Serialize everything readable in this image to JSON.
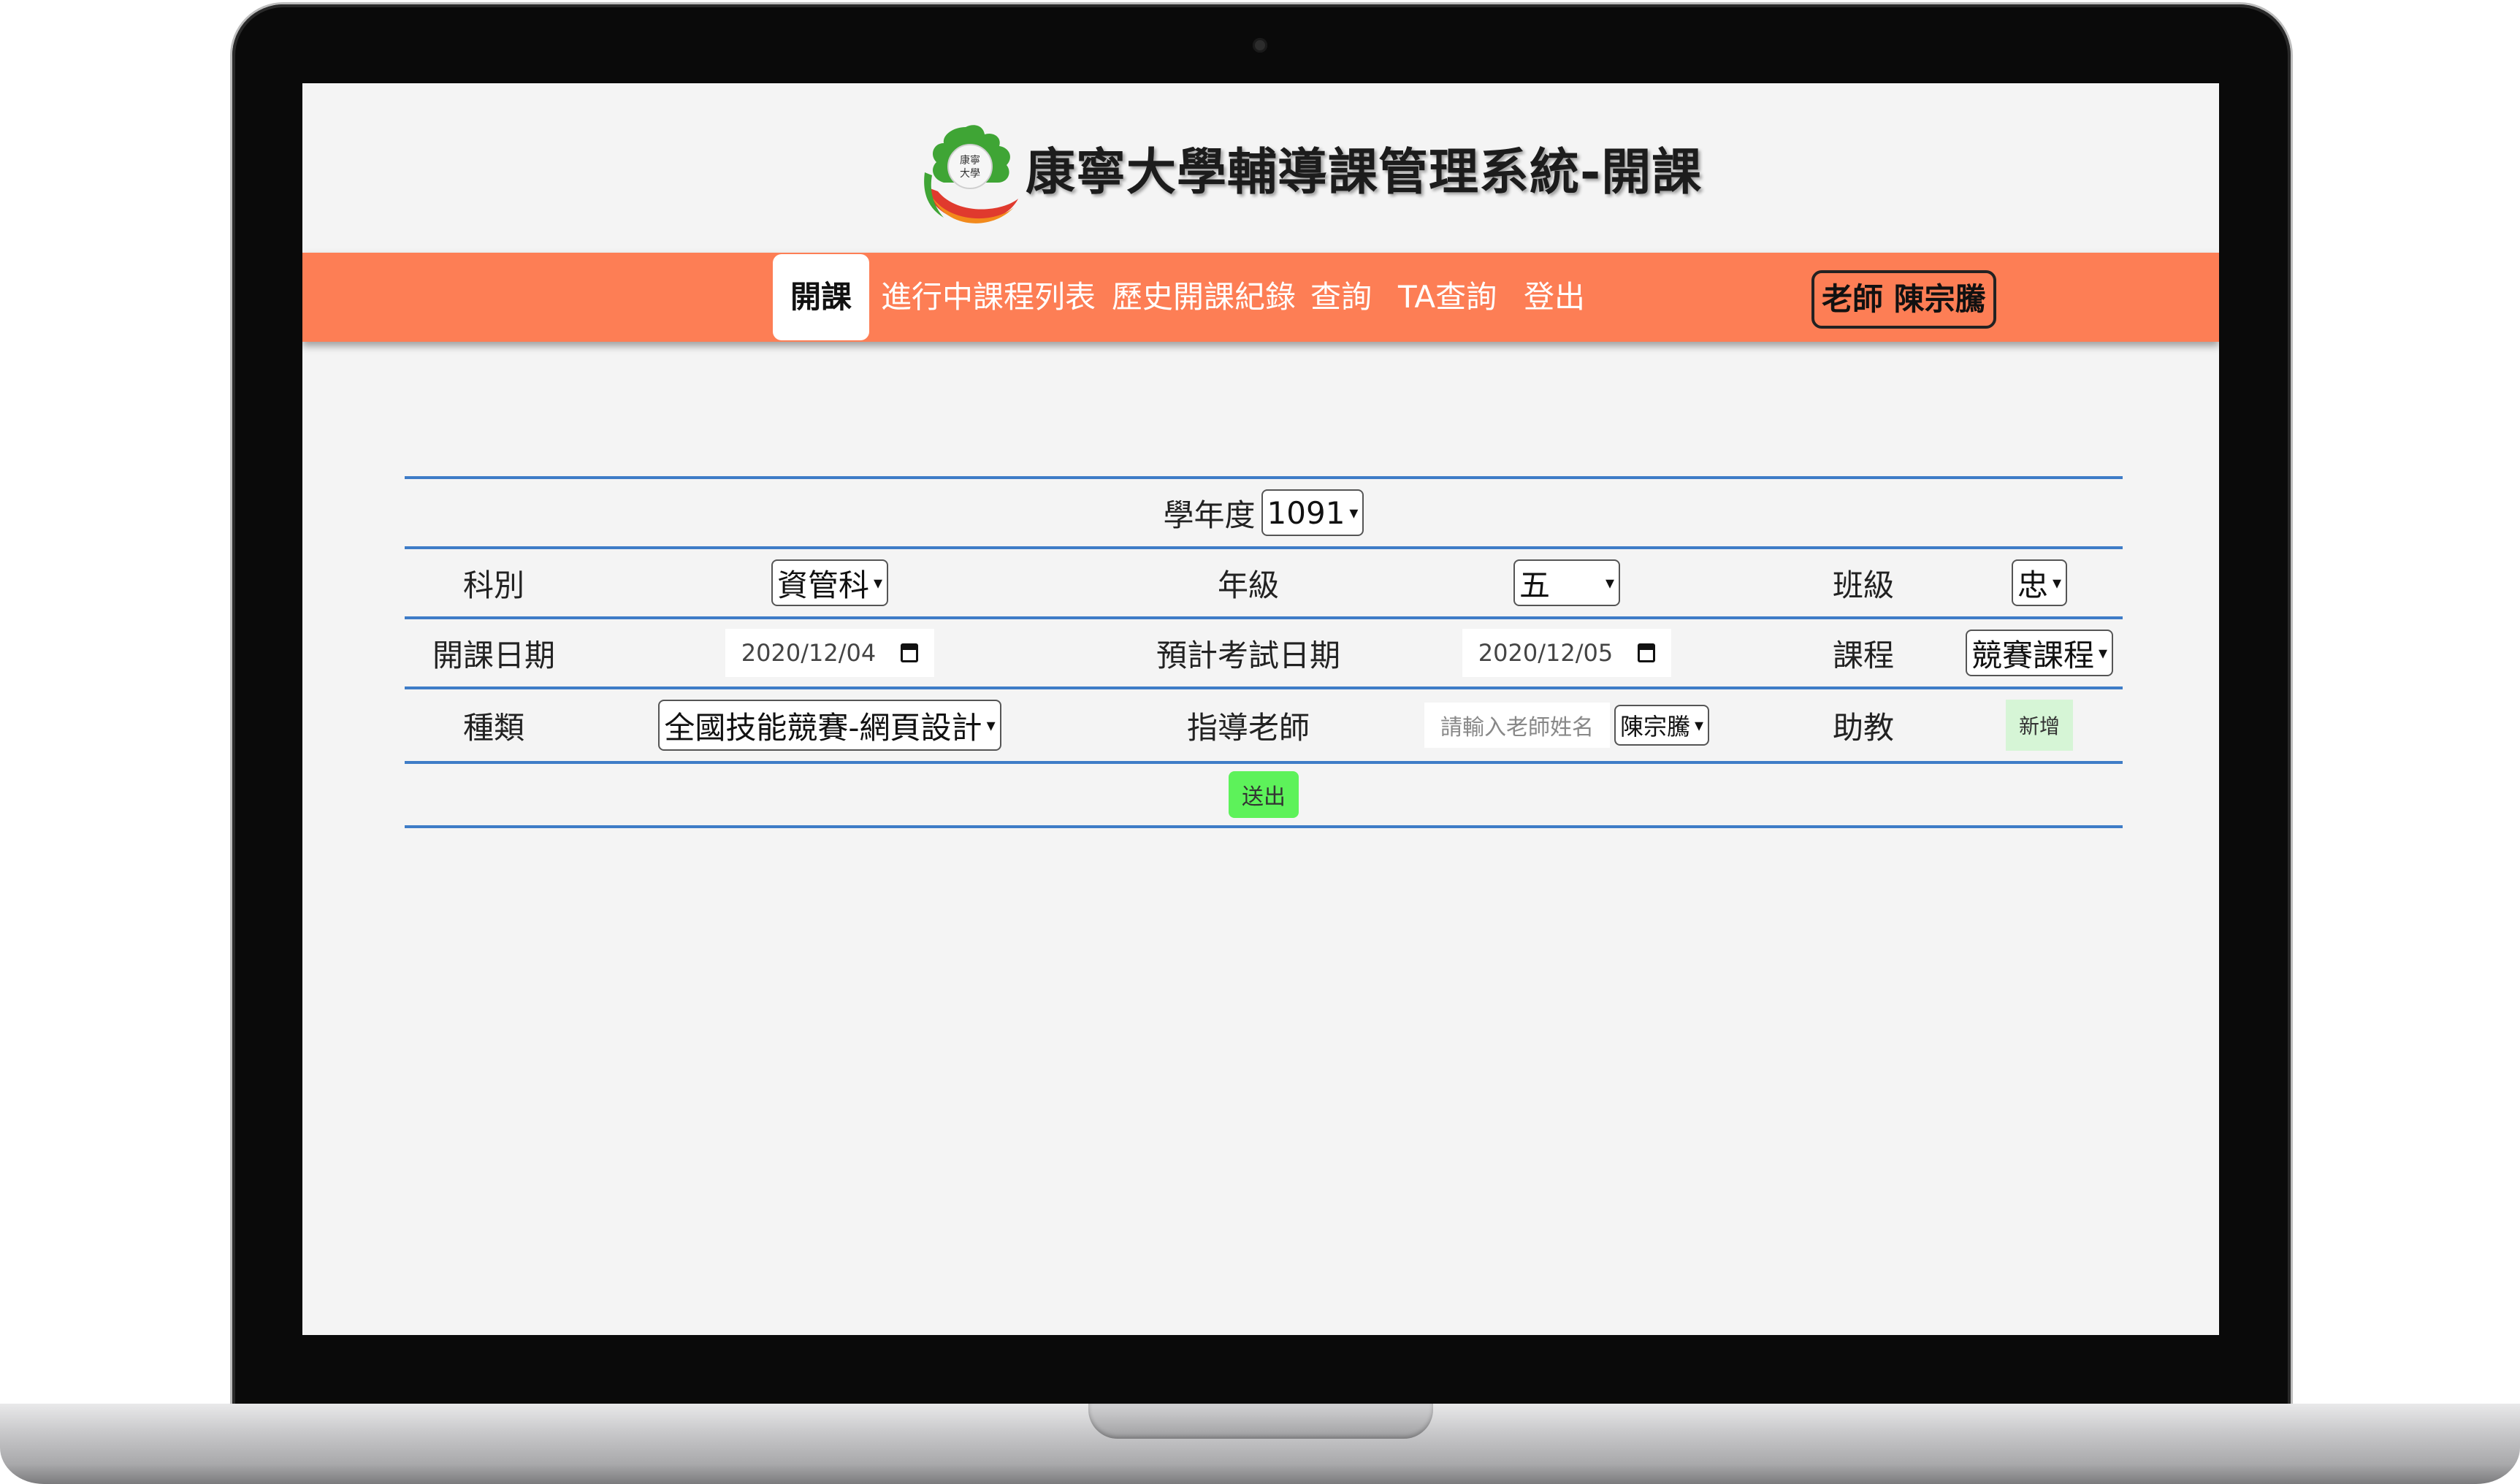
{
  "header": {
    "site_title": "康寧大學輔導課管理系統-開課",
    "logo_icon": "university-logo-icon"
  },
  "nav": {
    "items": [
      {
        "label": "開課",
        "active": true
      },
      {
        "label": "進行中課程列表",
        "active": false
      },
      {
        "label": "歷史開課紀錄",
        "active": false
      },
      {
        "label": "查詢",
        "active": false
      },
      {
        "label": "TA查詢",
        "active": false
      },
      {
        "label": "登出",
        "active": false
      }
    ],
    "user_badge": "老師 陳宗騰"
  },
  "form": {
    "academic_year": {
      "label": "學年度",
      "value": "1091"
    },
    "department": {
      "label": "科別",
      "value": "資管科"
    },
    "grade": {
      "label": "年級",
      "value": "五"
    },
    "class": {
      "label": "班級",
      "value": "忠"
    },
    "start_date": {
      "label": "開課日期",
      "value": "2020/12/04"
    },
    "exam_date": {
      "label": "預計考試日期",
      "value": "2020/12/05"
    },
    "course": {
      "label": "課程",
      "value": "競賽課程"
    },
    "type": {
      "label": "種類",
      "value": "全國技能競賽-網頁設計"
    },
    "teacher": {
      "label": "指導老師",
      "placeholder": "請輸入老師姓名",
      "value": "陳宗騰"
    },
    "assistant": {
      "label": "助教",
      "add_button": "新增"
    },
    "submit_button": "送出"
  },
  "colors": {
    "navbar": "#fd7e55",
    "row_divider": "#3e7cc7",
    "submit": "#5df25a",
    "add": "#d6f5d6"
  }
}
